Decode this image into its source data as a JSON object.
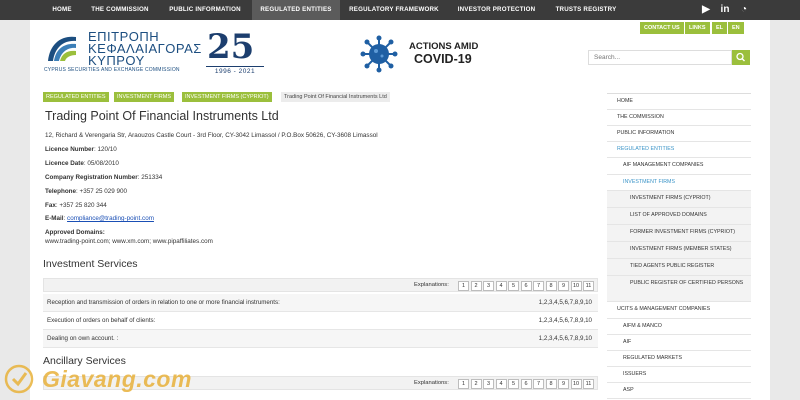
{
  "topnav": {
    "items": [
      "HOME",
      "THE COMMISSION",
      "PUBLIC INFORMATION",
      "REGULATED ENTITIES",
      "REGULATORY FRAMEWORK",
      "INVESTOR PROTECTION",
      "TRUSTS REGISTRY"
    ],
    "active_index": 3,
    "social_icons": [
      "youtube-icon",
      "linkedin-icon",
      "rss-icon"
    ]
  },
  "toplinks": {
    "contact": "CONTACT US",
    "links": "LINKS",
    "lang": "EL",
    "lang_active": "EN"
  },
  "logo": {
    "line1": "ΕΠΙΤΡΟΠΗ",
    "line2": "ΚΕΦΑΛΑΙΑΓΟΡΑΣ",
    "line3": "ΚΥΠΡΟΥ",
    "subtitle": "CYPRUS SECURITIES AND EXCHANGE COMMISSION",
    "anniversary": "25",
    "years": "1996 - 2021"
  },
  "covid": {
    "line1": "ACTIONS AMID",
    "line2": "COVID-19"
  },
  "search": {
    "placeholder": "Search..."
  },
  "breadcrumb": [
    "REGULATED ENTITIES",
    "INVESTMENT FIRMS",
    "INVESTMENT FIRMS (CYPRIOT)",
    "Trading Point Of Financial Instruments Ltd"
  ],
  "entity": {
    "title": "Trading Point Of Financial Instruments Ltd",
    "address": "12, Richard & Verengaria Str, Araouzos Castle Court - 3rd Floor, CY-3042 Limassol / P.O.Box 50626, CY-3608 Limassol",
    "licence_number_label": "Licence Number",
    "licence_number": ": 120/10",
    "licence_date_label": "Licence Date",
    "licence_date": ": 05/08/2010",
    "company_reg_label": "Company Registration Number",
    "company_reg": ": 251334",
    "telephone_label": "Telephone",
    "telephone": ": +357 25 029 900",
    "fax_label": "Fax",
    "fax": ": +357 25 820 344",
    "email_label": "E-Mail",
    "email_sep": ": ",
    "email": "compliance@trading-point.com",
    "domains_label": "Approved Domains",
    "domains_sep": ":",
    "domains": "www.trading-point.com; www.xm.com; www.pipaffiliates.com"
  },
  "investment_services": {
    "heading": "Investment Services",
    "explanations_label": "Explanations:",
    "numbers": [
      "1",
      "2",
      "3",
      "4",
      "5",
      "6",
      "7",
      "8",
      "9",
      "10",
      "11"
    ],
    "rows": [
      {
        "desc": "Reception and transmission of orders in relation to one or more financial instruments:",
        "nums": "1,2,3,4,5,6,7,8,9,10"
      },
      {
        "desc": "Execution of orders on behalf of clients:",
        "nums": "1,2,3,4,5,6,7,8,9,10"
      },
      {
        "desc": "Dealing on own account. :",
        "nums": "1,2,3,4,5,6,7,8,9,10"
      }
    ]
  },
  "ancillary_services": {
    "heading": "Ancillary Services",
    "explanations_label": "Explanations:",
    "numbers": [
      "1",
      "2",
      "3",
      "4",
      "5",
      "6",
      "7",
      "8",
      "9",
      "10",
      "11"
    ]
  },
  "sidebar": {
    "items": [
      {
        "label": "HOME",
        "indent": 0,
        "style": ""
      },
      {
        "label": "THE COMMISSION",
        "indent": 0,
        "style": ""
      },
      {
        "label": "PUBLIC INFORMATION",
        "indent": 0,
        "style": ""
      },
      {
        "label": "REGULATED ENTITIES",
        "indent": 0,
        "style": "accent"
      },
      {
        "label": "AIF MANAGEMENT COMPANIES",
        "indent": 1,
        "style": ""
      },
      {
        "label": "INVESTMENT FIRMS",
        "indent": 1,
        "style": "accent"
      },
      {
        "label": "INVESTMENT FIRMS (CYPRIOT)",
        "indent": 2,
        "style": ""
      },
      {
        "label": "LIST OF APPROVED DOMAINS",
        "indent": 2,
        "style": ""
      },
      {
        "label": "FORMER INVESTMENT FIRMS (CYPRIOT)",
        "indent": 2,
        "style": ""
      },
      {
        "label": "INVESTMENT FIRMS (MEMBER STATES)",
        "indent": 2,
        "style": ""
      },
      {
        "label": "TIED AGENTS PUBLIC REGISTER",
        "indent": 2,
        "style": ""
      },
      {
        "label": "PUBLIC REGISTER OF CERTIFIED PERSONS",
        "indent": 2,
        "style": ""
      },
      {
        "label": "UCITS & MANAGEMENT COMPANIES",
        "indent": 0,
        "style": ""
      },
      {
        "label": "AIFM & MANCO",
        "indent": 1,
        "style": ""
      },
      {
        "label": "AIF",
        "indent": 1,
        "style": ""
      },
      {
        "label": "REGULATED MARKETS",
        "indent": 1,
        "style": ""
      },
      {
        "label": "ISSUERS",
        "indent": 1,
        "style": ""
      },
      {
        "label": "ASP",
        "indent": 1,
        "style": ""
      }
    ]
  },
  "watermark": {
    "text": "Giavang.com"
  }
}
